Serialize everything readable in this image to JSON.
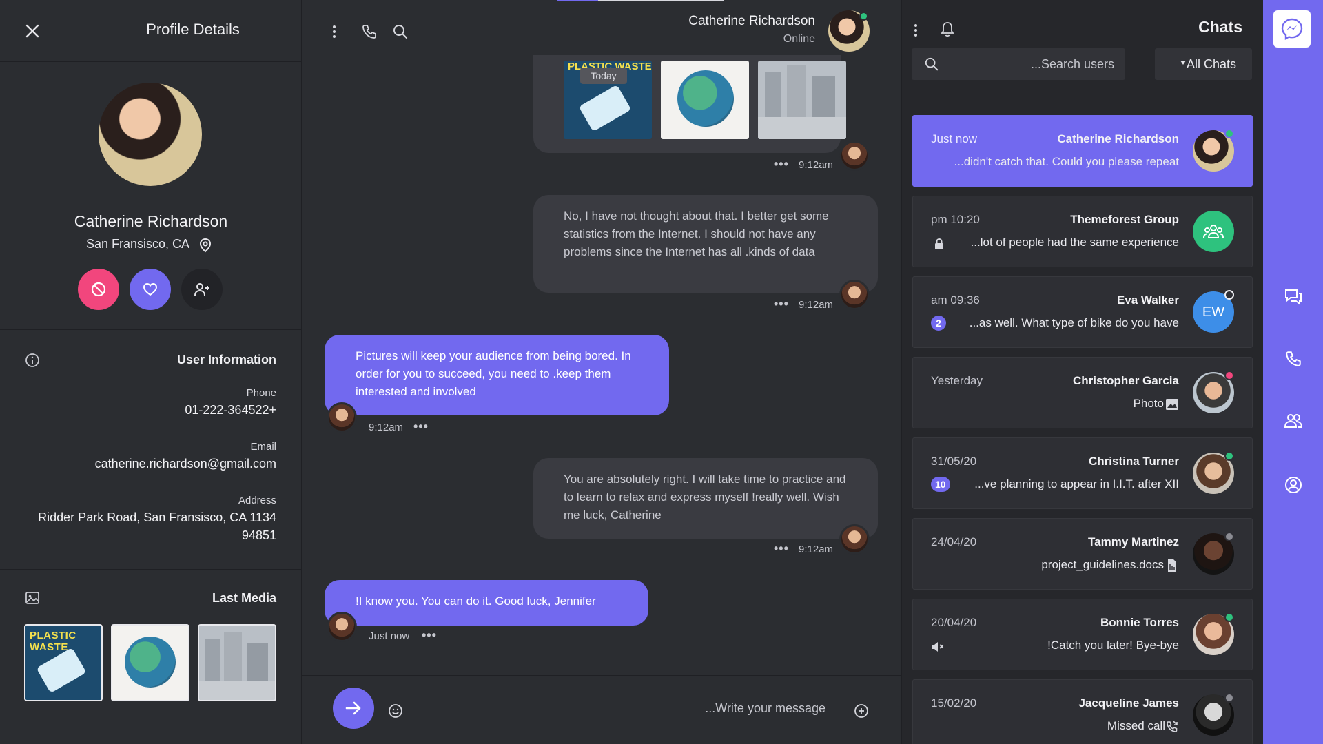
{
  "colors": {
    "accent": "#7269ef",
    "panel": "#2b2d31",
    "danger": "#f2467d",
    "online": "#2ec27e"
  },
  "profile": {
    "title": "Profile Details",
    "name": "Catherine Richardson",
    "location": "San Fransisco, CA",
    "info_title": "User Information",
    "phone_label": "Phone",
    "phone": "01-222-364522+",
    "email_label": "Email",
    "email": "catherine.richardson@gmail.com",
    "address_label": "Address",
    "address_line1": "Ridder Park Road, San Fransisco, CA 1134",
    "address_line2": "94851",
    "media_title": "Last Media",
    "media_thumb_text": "PLASTIC WASTE"
  },
  "chat": {
    "name": "Catherine Richardson",
    "status": "Online",
    "today": "Today",
    "messages": [
      {
        "text": "",
        "time": "9:12am"
      },
      {
        "text": "No, I have not thought about that. I better get some statistics from the Internet. I should not have any problems since the Internet has all .kinds of data",
        "time": "9:12am"
      },
      {
        "text": "Pictures will keep your audience from being bored. In order for you to succeed, you need to .keep them interested and involved",
        "time": "9:12am"
      },
      {
        "text": "You are absolutely right. I will take time to practice and to learn to relax and express myself !really well. Wish me luck, Catherine",
        "time": "9:12am"
      },
      {
        "text": "!I know you. You can do it. Good luck, Jennifer",
        "time": "Just now"
      }
    ],
    "input_placeholder": "...Write your message"
  },
  "chats_panel": {
    "title": "Chats",
    "search_placeholder": "...Search users",
    "filter_label": "All Chats",
    "items": [
      {
        "time": "Just now",
        "name": "Catherine Richardson",
        "message": "...didn't catch that. Could you please repeat",
        "status": "online"
      },
      {
        "time": "pm 10:20",
        "name": "Themeforest Group",
        "message": "...lot of people had the same experience",
        "status": ""
      },
      {
        "time": "am 09:36",
        "name": "Eva Walker",
        "message": "...as well. What type of bike do you have",
        "initials": "EW",
        "badge": "2",
        "status": "away"
      },
      {
        "time": "Yesterday",
        "name": "Christopher Garcia",
        "message": "Photo",
        "status": "busy"
      },
      {
        "time": "31/05/20",
        "name": "Christina Turner",
        "message": "...ve planning to appear in I.I.T. after XII",
        "badge": "10",
        "status": "online"
      },
      {
        "time": "24/04/20",
        "name": "Tammy Martinez",
        "message": "project_guidelines.docs",
        "status": "offline"
      },
      {
        "time": "20/04/20",
        "name": "Bonnie Torres",
        "message": "!Catch you later! Bye-bye",
        "status": "online"
      },
      {
        "time": "15/02/20",
        "name": "Jacqueline James",
        "message": "Missed call",
        "status": "offline"
      }
    ]
  },
  "icons": [
    "close-icon",
    "location-icon",
    "block-icon",
    "heart-icon",
    "add-user-icon",
    "info-icon",
    "image-icon",
    "more-vertical-icon",
    "phone-icon",
    "search-icon",
    "bell-icon",
    "send-icon",
    "emoji-icon",
    "attach-icon",
    "messenger-icon",
    "chat-icon",
    "group-icon",
    "profile-icon",
    "lock-icon",
    "mute-icon",
    "file-icon",
    "missed-call-icon",
    "photo-icon"
  ]
}
